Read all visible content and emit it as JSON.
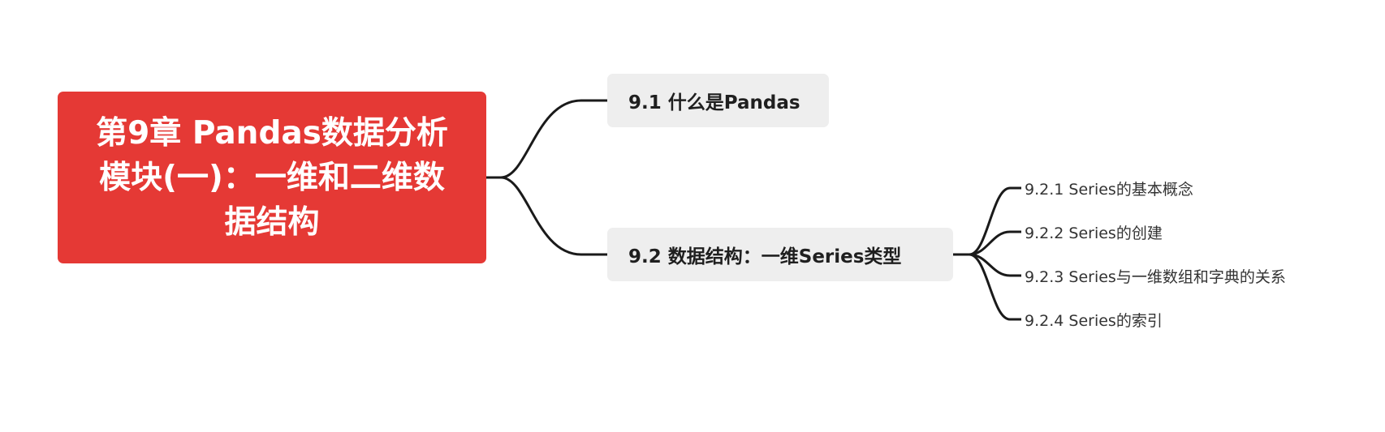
{
  "mindmap": {
    "root": {
      "label": "第9章 Pandas数据分析模块(一)：一维和二维数据结构"
    },
    "topics": [
      {
        "label": "9.1 什么是Pandas",
        "children": []
      },
      {
        "label": "9.2 数据结构：一维Series类型",
        "children": [
          {
            "label": "9.2.1 Series的基本概念"
          },
          {
            "label": "9.2.2 Series的创建"
          },
          {
            "label": "9.2.3 Series与一维数组和字典的关系"
          },
          {
            "label": "9.2.4 Series的索引"
          }
        ]
      }
    ],
    "colors": {
      "root_fill": "#e53935",
      "topic_fill": "#eeeeee",
      "connector": "#1a1a1a"
    }
  }
}
